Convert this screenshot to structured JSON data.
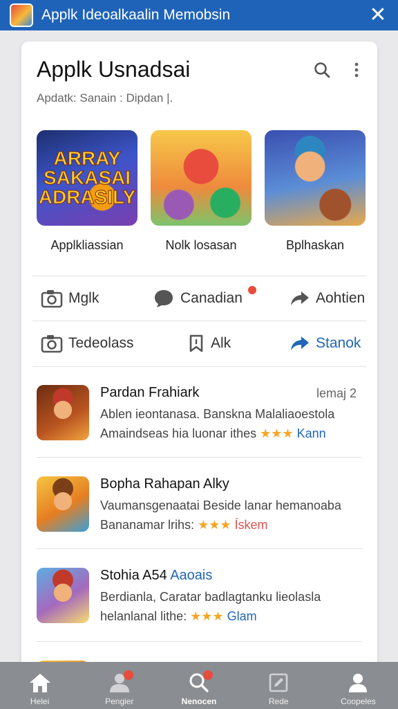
{
  "topbar": {
    "title": "Applk Ideoalkaalin Memobsin",
    "icons": {
      "app": "app-icon",
      "close": "close-icon"
    }
  },
  "card": {
    "title": "Applk Usnadsai",
    "subtitle": "Apdatk: Sanain : Dipdan |.",
    "header_icons": {
      "search": "search-icon",
      "more": "more-vertical-icon"
    }
  },
  "tiles": [
    {
      "label": "Applkliassian",
      "art_text": "ARRAY SAKASAI ADRASILY"
    },
    {
      "label": "Nolk losasan"
    },
    {
      "label": "Bplhaskan"
    }
  ],
  "actions_row1": [
    {
      "label": "Mglk",
      "icon": "camera-icon"
    },
    {
      "label": "Canadian",
      "icon": "chat-bubble-icon",
      "badge": true
    },
    {
      "label": "Aohtien",
      "icon": "share-arrow-icon"
    }
  ],
  "actions_row2": [
    {
      "label": "Tedeolass",
      "icon": "camera-icon"
    },
    {
      "label": "Alk",
      "icon": "bookmark-icon"
    },
    {
      "label": "Stanok",
      "icon": "share-arrow-icon",
      "accent": true
    }
  ],
  "list": [
    {
      "title": "Pardan Frahiark",
      "meta": "lemaj 2",
      "line1": "Ablen ieontanasa. Banskna Malaliaoestola",
      "line2": "Amaindseas hia luonar ithes",
      "stars": "★★★",
      "link": "Kann"
    },
    {
      "title": "Bopha Rahapan Alky",
      "line1": "Vaumansgenaatai Beside lanar hemanoaba",
      "line2": "Bananamar lrihs:",
      "stars": "★★★",
      "link": "Ískem"
    },
    {
      "title": "Stohia A54",
      "tag": "Aaoais",
      "line1": "Berdianla, Caratar badlagtanku lieolasla",
      "line2": "helanlanal lithe:",
      "stars": "★★★",
      "link": "Glam"
    }
  ],
  "bottom_nav": [
    {
      "label": "Helei",
      "icon": "home-icon"
    },
    {
      "label": "Pengier",
      "icon": "people-icon",
      "badge": true
    },
    {
      "label": "Nenocen",
      "icon": "search-icon",
      "badge": true,
      "active": true
    },
    {
      "label": "Rede",
      "icon": "edit-icon"
    },
    {
      "label": "Coopeles",
      "icon": "person-icon"
    }
  ],
  "colors": {
    "topbar": "#1f63b8",
    "accent_blue": "#2166b8",
    "badge_red": "#e74c3c",
    "star": "#f5a623",
    "bottom_nav": "#8a8d91"
  }
}
